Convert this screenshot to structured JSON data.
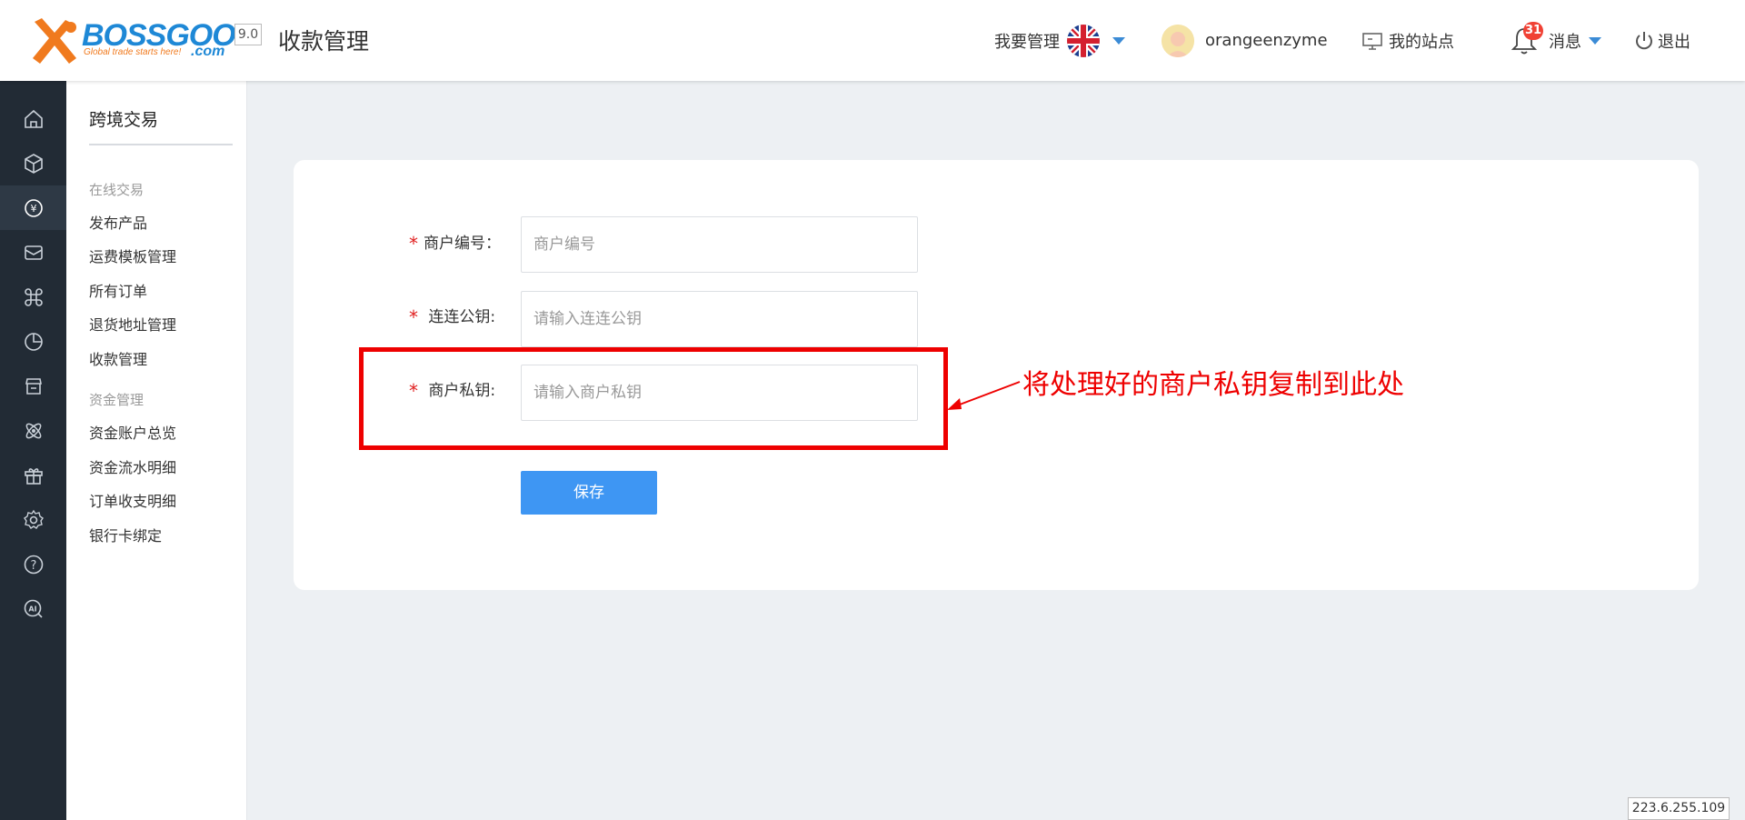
{
  "header": {
    "logo_text": "BOSSGOO",
    "logo_tagline": "Global trade starts here!",
    "logo_domain": ".com",
    "version": "9.0",
    "page_title": "收款管理",
    "manage_label": "我要管理",
    "language_flag": "uk-flag-icon",
    "username": "orangeenzyme",
    "my_site_label": "我的站点",
    "messages_label": "消息",
    "messages_count": "31",
    "logout_label": "退出"
  },
  "iconbar": {
    "items": [
      {
        "name": "home-icon"
      },
      {
        "name": "product-box-icon"
      },
      {
        "name": "trade-yen-icon",
        "active": true
      },
      {
        "name": "mail-icon"
      },
      {
        "name": "command-icon"
      },
      {
        "name": "pie-chart-icon"
      },
      {
        "name": "store-icon"
      },
      {
        "name": "atom-icon"
      },
      {
        "name": "gift-icon"
      },
      {
        "name": "settings-icon"
      },
      {
        "name": "help-icon"
      },
      {
        "name": "ai-search-icon"
      }
    ]
  },
  "submenu": {
    "title": "跨境交易",
    "group1": "在线交易",
    "items1": [
      "发布产品",
      "运费模板管理",
      "所有订单",
      "退货地址管理",
      "收款管理"
    ],
    "group2": "资金管理",
    "items2": [
      "资金账户总览",
      "资金流水明细",
      "订单收支明细",
      "银行卡绑定"
    ]
  },
  "form": {
    "required_mark": "*",
    "merchant_id_label": "商户编号：",
    "merchant_id_placeholder": "商户编号",
    "public_key_label": "连连公钥:",
    "public_key_placeholder": "请输入连连公钥",
    "private_key_label": "商户私钥:",
    "private_key_placeholder": "请输入商户私钥",
    "save_label": "保存"
  },
  "annotation": {
    "text": "将处理好的商户私钥复制到此处",
    "color": "#ee0000"
  },
  "footer": {
    "ip": "223.6.255.109"
  },
  "colors": {
    "primary": "#3e96f3",
    "sidebar_bg": "#222b35",
    "badge": "#f04134"
  }
}
